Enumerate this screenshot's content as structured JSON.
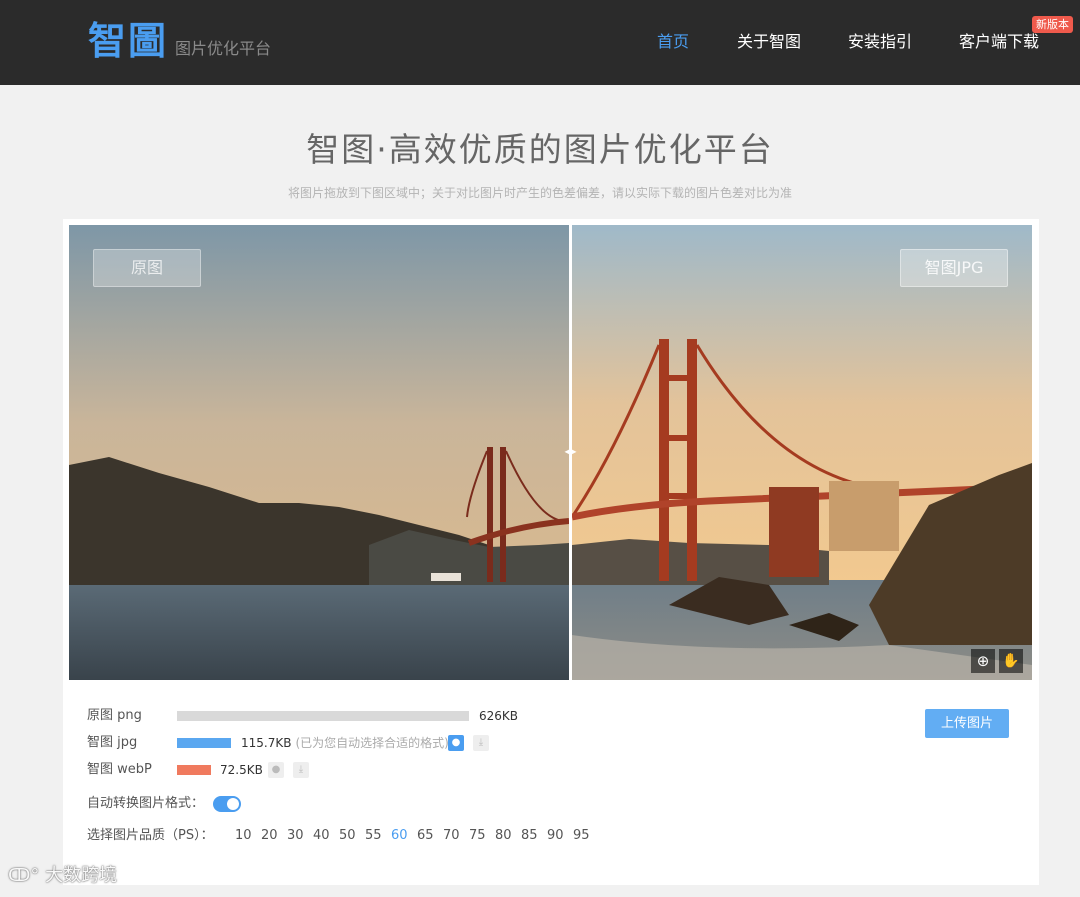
{
  "header": {
    "logo": "智圖",
    "tagline": "图片优化平台",
    "nav": [
      {
        "label": "首页",
        "active": true
      },
      {
        "label": "关于智图",
        "active": false
      },
      {
        "label": "安装指引",
        "active": false
      },
      {
        "label": "客户端下载",
        "active": false
      }
    ],
    "new_badge": "新版本"
  },
  "hero": {
    "title": "智图·高效优质的图片优化平台",
    "subtitle": "将图片拖放到下图区域中；关于对比图片时产生的色差偏差，请以实际下载的图片色差对比为准"
  },
  "compare": {
    "left_label": "原图",
    "right_label": "智图JPG",
    "zoom_icon": "zoom-in-icon",
    "color_icon": "color-drop-icon"
  },
  "stats": [
    {
      "label": "原图 png",
      "size": "626KB",
      "bar_fraction": 1.0,
      "bar_color": "#d9d9d9",
      "note": ""
    },
    {
      "label": "智图 jpg",
      "size": "115.7KB",
      "bar_fraction": 0.185,
      "bar_color": "#5aa7f0",
      "note": "(已为您自动选择合适的格式)"
    },
    {
      "label": "智图 webP",
      "size": "72.5KB",
      "bar_fraction": 0.116,
      "bar_color": "#f07a5e",
      "note": ""
    }
  ],
  "upload_label": "上传图片",
  "auto_convert": {
    "label": "自动转换图片格式：",
    "enabled": true
  },
  "quality": {
    "label": "选择图片品质（PS）：",
    "options": [
      "10",
      "20",
      "30",
      "40",
      "50",
      "55",
      "60",
      "65",
      "70",
      "75",
      "80",
      "85",
      "90",
      "95"
    ],
    "selected": "60"
  },
  "watermark": "大数跨境"
}
